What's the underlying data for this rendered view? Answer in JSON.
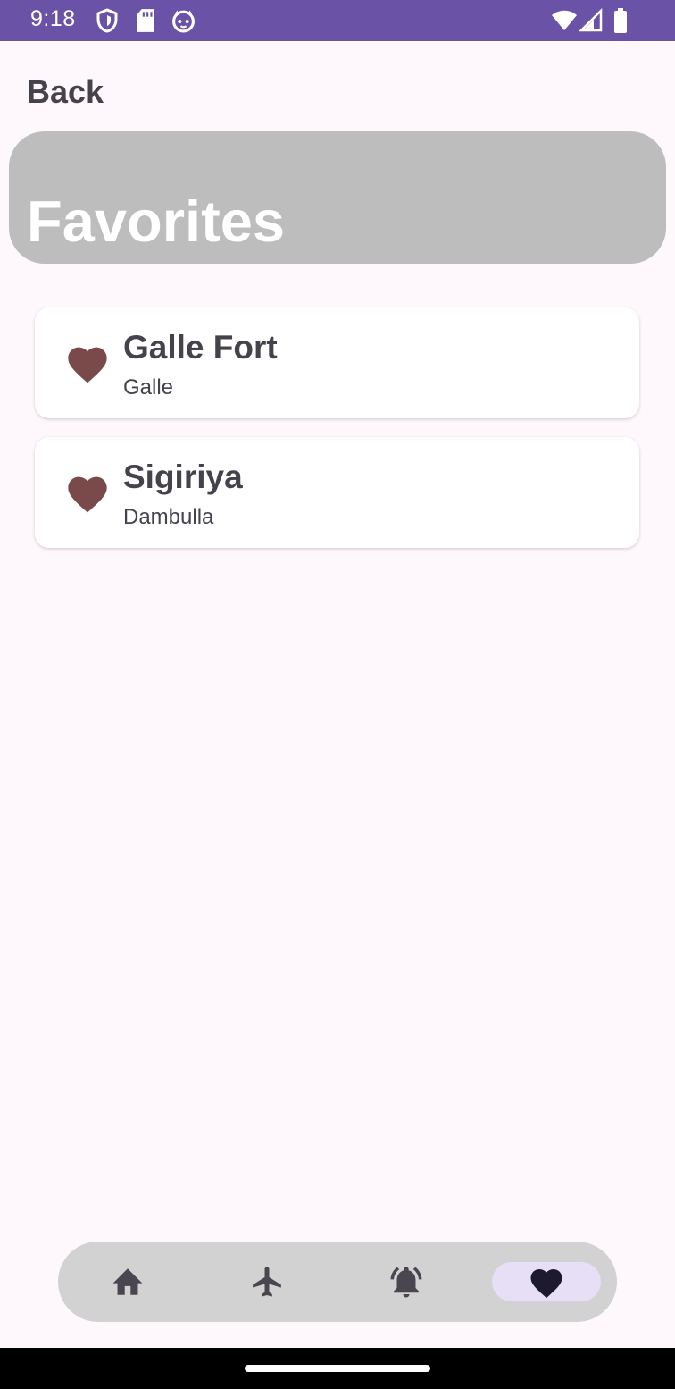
{
  "status_bar": {
    "time": "9:18",
    "left_icons": [
      "shield-icon",
      "sd-card-icon",
      "cat-face-icon"
    ],
    "right_icons": [
      "wifi-icon",
      "signal-icon",
      "battery-icon"
    ],
    "background": "#6a52a6"
  },
  "nav": {
    "back_label": "Back"
  },
  "header": {
    "title": "Favorites",
    "background": "#bdbdbd"
  },
  "favorites": [
    {
      "title": "Galle Fort",
      "subtitle": "Galle",
      "icon": "heart-icon"
    },
    {
      "title": "Sigiriya",
      "subtitle": "Dambulla",
      "icon": "heart-icon"
    }
  ],
  "bottom_nav": {
    "items": [
      {
        "icon": "home-icon",
        "active": false
      },
      {
        "icon": "airplane-icon",
        "active": false
      },
      {
        "icon": "notification-bell-icon",
        "active": false
      },
      {
        "icon": "heart-icon",
        "active": true
      }
    ],
    "active_background": "#e7dff6"
  },
  "colors": {
    "heart": "#7a4a4a",
    "text": "#46424c",
    "page_background": "#fef7fb"
  }
}
